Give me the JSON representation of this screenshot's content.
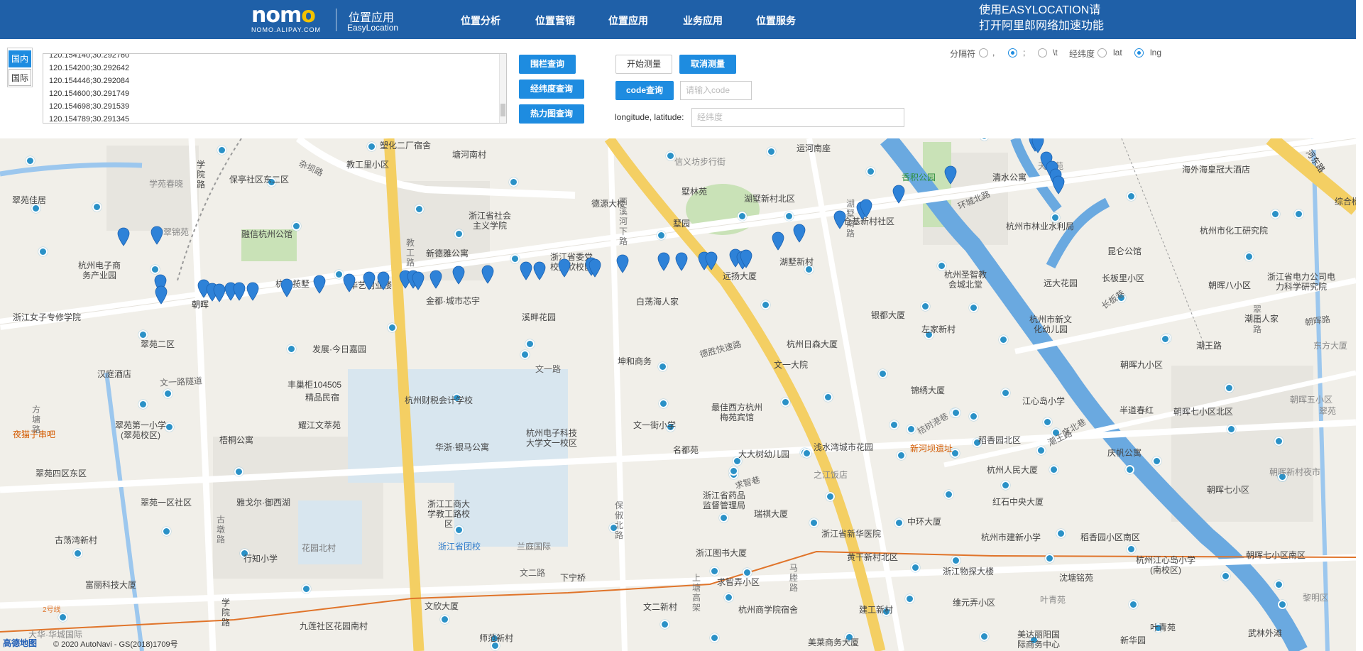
{
  "header": {
    "logo_text": "nomo",
    "logo_sub": "NOMO.ALIPAY.COM",
    "title": "位置应用",
    "title_en": "EasyLocation",
    "nav": [
      "位置分析",
      "位置营销",
      "位置应用",
      "业务应用",
      "位置服务"
    ],
    "notice_line1": "使用EASYLOCATION请",
    "notice_line2": "打开阿里郎网络加速功能"
  },
  "region": {
    "domestic": "国内",
    "international": "国际"
  },
  "coords": {
    "lines": [
      "120.154140;30.292760",
      "120.154200;30.292642",
      "120.154446;30.292084",
      "120.154600;30.291749",
      "120.154698;30.291539",
      "120.154789;30.291345"
    ]
  },
  "buttons": {
    "fence_query": "围栏查询",
    "latlng_query": "经纬度查询",
    "heatmap_query": "热力图查询",
    "start_measure": "开始测量",
    "cancel_measure": "取消测量",
    "code_query": "code查询"
  },
  "inputs": {
    "code_placeholder": "请输入code",
    "latlng_label": "longitude, latitude:",
    "latlng_placeholder": "经纬度"
  },
  "options": {
    "separator_label": "分隔符",
    "sep_comma": ",",
    "sep_semicolon": ";",
    "sep_tab": "\\t",
    "order_label": "经纬度",
    "order_lat": "lat",
    "order_lng": "lng"
  },
  "map": {
    "copyright": "© 2020 AutoNavi - GS(2018)1709号",
    "amap_logo": "高德地图",
    "labels": [
      {
        "t": "塑化二厂宿舍"
      },
      {
        "t": "塘河南村"
      },
      {
        "t": "教工里小区"
      },
      {
        "t": "学院路"
      },
      {
        "t": "学苑春晓"
      },
      {
        "t": "保亭社区东二区"
      },
      {
        "t": "杂坝路"
      },
      {
        "t": "翠苑佳居"
      },
      {
        "t": "浙江省社会主义学院"
      },
      {
        "t": "德源大楼"
      },
      {
        "t": "信义坊步行街"
      },
      {
        "t": "墅林苑"
      },
      {
        "t": "湖墅新村北区"
      },
      {
        "t": "运河南座"
      },
      {
        "t": "香积公园"
      },
      {
        "t": "清水公寓"
      },
      {
        "t": "天时苑"
      },
      {
        "t": "海外海皇冠大酒店"
      },
      {
        "t": "综合楼"
      },
      {
        "t": "翠锦苑"
      },
      {
        "t": "融信杭州公馆"
      },
      {
        "t": "新德雅公寓"
      },
      {
        "t": "浙江省委党校文欣校区"
      },
      {
        "t": "墅园"
      },
      {
        "t": "仓基新村社区"
      },
      {
        "t": "杭州市林业水利局"
      },
      {
        "t": "杭州市化工研究院"
      },
      {
        "t": "杭州电子商务产业园"
      },
      {
        "t": "杭房揽墅"
      },
      {
        "t": "华艺创业楼"
      },
      {
        "t": "金都·城市芯宇"
      },
      {
        "t": "远扬大厦"
      },
      {
        "t": "湖墅新村"
      },
      {
        "t": "杭州圣智教会城北堂"
      },
      {
        "t": "昆仑公馆"
      },
      {
        "t": "远大花园"
      },
      {
        "t": "长板里小区"
      },
      {
        "t": "朝晖八小区"
      },
      {
        "t": "浙江省电力公司电力科学研究院"
      },
      {
        "t": "浙江女子专修学院"
      },
      {
        "t": "溪畔花园"
      },
      {
        "t": "白荡海人家"
      },
      {
        "t": "银都大厦"
      },
      {
        "t": "左家新村"
      },
      {
        "t": "杭州市新文化幼儿园"
      },
      {
        "t": "潮王人家"
      },
      {
        "t": "翠苑二区"
      },
      {
        "t": "发展·今日嘉园"
      },
      {
        "t": "杭州日森大厦"
      },
      {
        "t": "潮王路"
      },
      {
        "t": "东方大厦"
      },
      {
        "t": "汉庭酒店"
      },
      {
        "t": "坤和商务"
      },
      {
        "t": "德胜快速路"
      },
      {
        "t": "文一大院"
      },
      {
        "t": "朝晖九小区"
      },
      {
        "t": "文一路隧道"
      },
      {
        "t": "丰巢柜104505"
      },
      {
        "t": "精品民宿"
      },
      {
        "t": "文一路"
      },
      {
        "t": "杭州财税会计学校"
      },
      {
        "t": "锦绣大厦"
      },
      {
        "t": "江心岛小学"
      },
      {
        "t": "半道春红"
      },
      {
        "t": "朝晖七小区北区"
      },
      {
        "t": "朝晖五小区"
      },
      {
        "t": "翠苑第一小学(翠苑校区)"
      },
      {
        "t": "夜猫子串吧"
      },
      {
        "t": "耀江文萃苑"
      },
      {
        "t": "最佳西方杭州梅苑宾馆"
      },
      {
        "t": "文一街小学"
      },
      {
        "t": "杭州电子科技大学文一校区"
      },
      {
        "t": "稻香园北区"
      },
      {
        "t": "梧桐公寓"
      },
      {
        "t": "华浙·银马公寓"
      },
      {
        "t": "名都苑"
      },
      {
        "t": "大大树幼儿园"
      },
      {
        "t": "浅水湾城市花园"
      },
      {
        "t": "新河坝遗址"
      },
      {
        "t": "庆帆公寓"
      },
      {
        "t": "翠苑四区东区"
      },
      {
        "t": "之江饭店"
      },
      {
        "t": "杭州人民大厦"
      },
      {
        "t": "朝晖新村夜市"
      },
      {
        "t": "浙江省药品监督管理局"
      },
      {
        "t": "浙江工商大学教工路校区"
      },
      {
        "t": "翠苑一区社区"
      },
      {
        "t": "雅戈尔·御西湖"
      },
      {
        "t": "瑞祺大厦"
      },
      {
        "t": "红石中央大厦"
      },
      {
        "t": "朝晖七小区"
      },
      {
        "t": "古荡湾新村"
      },
      {
        "t": "中环大厦"
      },
      {
        "t": "浙江省新华医院"
      },
      {
        "t": "杭州市建新小学"
      },
      {
        "t": "稻香园小区南区"
      },
      {
        "t": "杭州江心岛小学(南校区)"
      },
      {
        "t": "花园北村"
      },
      {
        "t": "浙江省团校"
      },
      {
        "t": "兰庭国际"
      },
      {
        "t": "行知小学"
      },
      {
        "t": "浙江图书大厦"
      },
      {
        "t": "黄干新村北区"
      },
      {
        "t": "朝晖七小区南区"
      },
      {
        "t": "浙江物探大楼"
      },
      {
        "t": "沈塘铭苑"
      },
      {
        "t": "文二路"
      },
      {
        "t": "下宁桥"
      },
      {
        "t": "求智弄小区"
      },
      {
        "t": "富丽科技大厦"
      },
      {
        "t": "学院路"
      },
      {
        "t": "文欣大厦"
      },
      {
        "t": "文二新村"
      },
      {
        "t": "杭州商学院宿舍"
      },
      {
        "t": "建工新村"
      },
      {
        "t": "维元弄小区"
      },
      {
        "t": "叶青苑"
      },
      {
        "t": "黎明区"
      },
      {
        "t": "九莲社区花园南村"
      },
      {
        "t": "美达丽阳国际商务中心"
      },
      {
        "t": "叶青苑"
      },
      {
        "t": "武林外滩"
      },
      {
        "t": "大华·华城国际"
      },
      {
        "t": "师范新村"
      },
      {
        "t": "美莱商务大厦"
      },
      {
        "t": "新华园"
      },
      {
        "t": "2号线"
      },
      {
        "t": "翠苑"
      },
      {
        "t": "方墉路"
      },
      {
        "t": "古墩路"
      },
      {
        "t": "教工路"
      },
      {
        "t": "西溪河下路"
      },
      {
        "t": "保俶北路"
      },
      {
        "t": "马塍路"
      },
      {
        "t": "湖墅南路"
      },
      {
        "t": "桔树港巷"
      },
      {
        "t": "环城北路"
      },
      {
        "t": "潮王路"
      },
      {
        "t": "朝晖路"
      },
      {
        "t": "长板巷"
      },
      {
        "t": "文北巷"
      },
      {
        "t": "求智巷"
      },
      {
        "t": "上塘高架"
      },
      {
        "t": "河东路"
      },
      {
        "t": "翠柏路"
      },
      {
        "t": "朝晖"
      }
    ]
  },
  "colors": {
    "header_bg": "#1f60a8",
    "accent": "#1e8ce0",
    "map_bg": "#f1efe9",
    "river": "#6aa9e0",
    "road_yellow": "#f4cf63",
    "metro_line": "#e0742a",
    "pin": "#2e82d8",
    "poi": "#2a91c7"
  }
}
